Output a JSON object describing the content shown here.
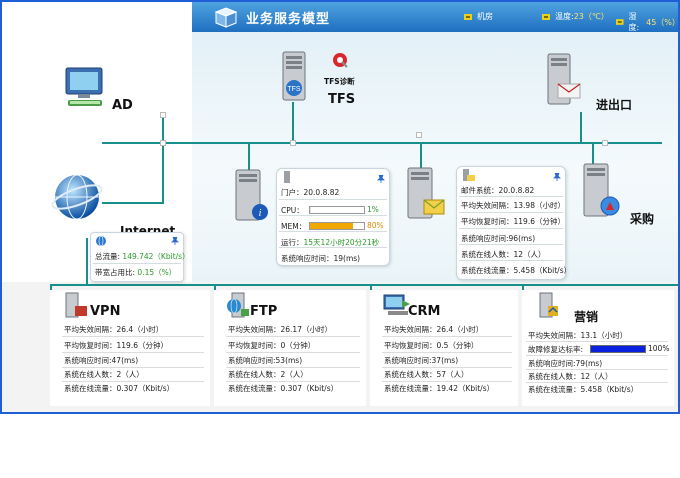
{
  "header": {
    "title": "业务服务模型",
    "status": [
      {
        "label": "机房",
        "value": ""
      },
      {
        "label": "温度:",
        "value": "23（℃）"
      },
      {
        "label": "湿度:",
        "value": "45（%）"
      }
    ]
  },
  "nodes": {
    "ad": "AD",
    "internet": "Internet",
    "tfs": "TFS",
    "tfs_diag": "TFS诊断",
    "inout": "进出口",
    "purchase": "采购"
  },
  "internet_card": {
    "total_flow_label": "总流量:",
    "total_flow_value": "149.742（Kbit/s）",
    "bandwidth_label": "带宽占用比:",
    "bandwidth_value": "0.15（%）"
  },
  "portal_card": {
    "name": "门户：20.0.8.82",
    "cpu_label": "CPU：",
    "cpu_value": "1%",
    "cpu_pct": 1,
    "mem_label": "MEM：",
    "mem_value": "80%",
    "mem_pct": 80,
    "uptime_label": "运行：",
    "uptime_value": "15天12小时20分21秒",
    "response": "系统响应时间：19(ms)"
  },
  "mail_card": {
    "name": "邮件系统：20.0.8.82",
    "mtbf": "平均失效间隔：13.98（小时）",
    "mttr": "平均恢复时间：119.6（分钟）",
    "response": "系统响应时间:96(ms)",
    "online": "系统在线人数：12（人）",
    "flow": "系统在线流量：5.458（Kbit/s）"
  },
  "panels": [
    {
      "title": "VPN",
      "rows": [
        "平均失效间隔：26.4（小时）",
        "平均恢复时间：119.6（分钟）",
        "系统响应时间:47(ms)",
        "系统在线人数：2（人）",
        "系统在线流量：0.307（Kbit/s）"
      ]
    },
    {
      "title": "FTP",
      "rows": [
        "平均失效间隔：26.17（小时）",
        "平均恢复时间：0（分钟）",
        "系统响应时间:53(ms)",
        "系统在线人数：2（人）",
        "系统在线流量：0.307（Kbit/s）"
      ]
    },
    {
      "title": "CRM",
      "rows": [
        "平均失效间隔：26.4（小时）",
        "平均恢复时间：0.5（分钟）",
        "系统响应时间:37(ms)",
        "系统在线人数：57（人）",
        "系统在线流量：19.42（Kbit/s）"
      ]
    },
    {
      "title": "营销",
      "rows": [
        "平均失效间隔：13.1（小时）",
        "故障修复达标率:",
        "系统响应时间:79(ms)",
        "系统在线人数：12（人）",
        "系统在线流量：5.458（Kbit/s）"
      ],
      "repair_value": "100%",
      "repair_pct": 100
    }
  ],
  "colors": {
    "frame": "#1e5fd8",
    "line": "#178f8a",
    "cpu_bar": "#e0e0e0",
    "mem_bar": "#f0a800",
    "repair_bar": "#0a22e0"
  }
}
